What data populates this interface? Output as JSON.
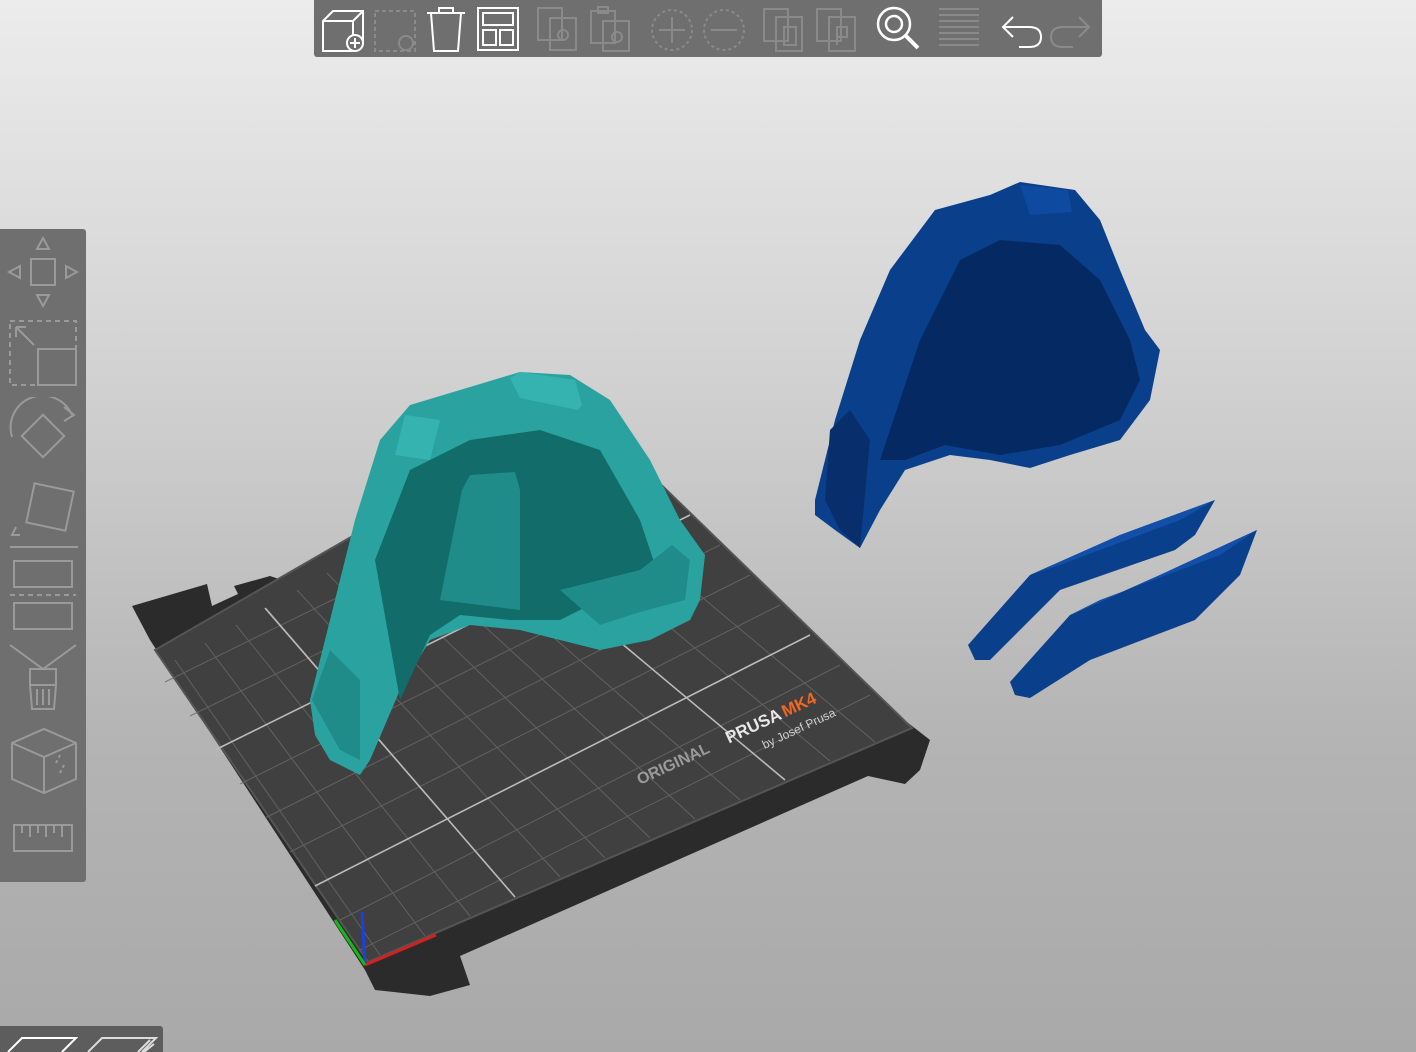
{
  "toolbar": {
    "buttons": [
      {
        "name": "add-object-button",
        "icon": "cube-add-icon",
        "enabled": true
      },
      {
        "name": "delete-button",
        "icon": "delete-selection-icon",
        "enabled": false
      },
      {
        "name": "delete-all-button",
        "icon": "trash-icon",
        "enabled": true
      },
      {
        "name": "arrange-button",
        "icon": "arrange-icon",
        "enabled": true
      },
      {
        "name": "copy-button",
        "icon": "copy-icon",
        "enabled": false
      },
      {
        "name": "paste-button",
        "icon": "paste-icon",
        "enabled": false
      },
      {
        "name": "add-instance-button",
        "icon": "plus-circle-icon",
        "enabled": false
      },
      {
        "name": "remove-instance-button",
        "icon": "minus-circle-icon",
        "enabled": false
      },
      {
        "name": "split-objects-button",
        "icon": "split-objects-icon",
        "enabled": false
      },
      {
        "name": "split-parts-button",
        "icon": "split-parts-icon",
        "enabled": false
      },
      {
        "name": "search-button",
        "icon": "search-icon",
        "enabled": true
      },
      {
        "name": "layers-button",
        "icon": "layers-icon",
        "enabled": false
      },
      {
        "name": "undo-button",
        "icon": "undo-icon",
        "enabled": true
      },
      {
        "name": "redo-button",
        "icon": "redo-icon",
        "enabled": false
      }
    ]
  },
  "gizmos": [
    {
      "name": "move-tool",
      "icon": "move-icon"
    },
    {
      "name": "scale-tool",
      "icon": "scale-icon"
    },
    {
      "name": "rotate-tool",
      "icon": "rotate-icon"
    },
    {
      "name": "place-on-face-tool",
      "icon": "place-on-face-icon"
    },
    {
      "name": "cut-tool",
      "icon": "cut-icon"
    },
    {
      "name": "paint-tool",
      "icon": "paint-brush-icon"
    },
    {
      "name": "seam-tool",
      "icon": "seam-cube-icon"
    },
    {
      "name": "measure-tool",
      "icon": "ruler-icon"
    }
  ],
  "bed": {
    "brand_prefix": "ORIGINAL",
    "brand_name": "PRUSA",
    "model": "MK4",
    "byline": "by Josef Prusa"
  },
  "colors": {
    "panel": "#6f6f6f",
    "model_teal": "#2aa3a0",
    "model_blue": "#0a3f8c",
    "bed_sheet": "#3a3a3a",
    "accent_orange": "#f26522"
  },
  "view_tabs": [
    {
      "name": "3d-view-tab",
      "icon": "3d-editor-icon"
    },
    {
      "name": "preview-tab",
      "icon": "preview-icon"
    }
  ]
}
